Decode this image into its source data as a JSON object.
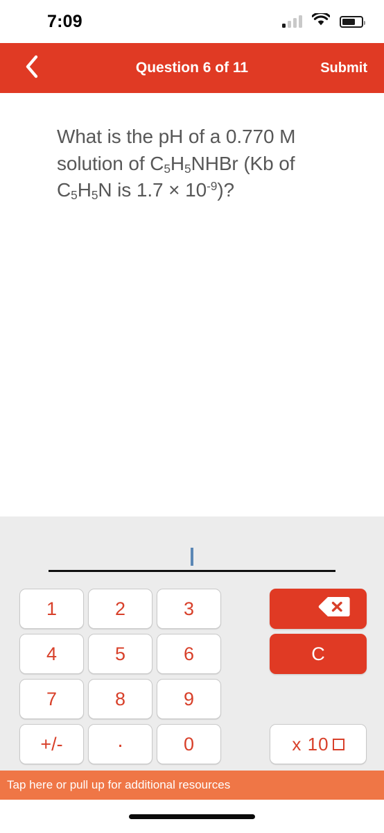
{
  "status_bar": {
    "time": "7:09",
    "signal_icon": "cellular-signal-icon",
    "wifi_icon": "wifi-icon",
    "battery_icon": "battery-icon",
    "battery_level": 70,
    "signal_bars_active": 1
  },
  "header": {
    "back_icon": "chevron-left-icon",
    "title": "Question 6 of 11",
    "submit_label": "Submit",
    "background_color": "#E03A24"
  },
  "question": {
    "line1_pre": "What is the pH of a 0.770 M",
    "full_text": "What is the pH of a 0.770 M solution of C5H5NHBr (Kb of C5H5N is 1.7 × 10⁻⁹)?",
    "segments": {
      "p1": "What is the pH of a 0.770 M solution of C",
      "sub1": "5",
      "p2": "H",
      "sub2": "5",
      "p3": "NHBr (Kb of C",
      "sub3": "5",
      "p4": "H",
      "sub4": "5",
      "p5": "N is 1.7 × 10",
      "sup1": "-9",
      "p6": ")?"
    },
    "text_color": "#575757"
  },
  "answer_input": {
    "value": "",
    "caret_visible": true,
    "caret_color": "#5b87b5",
    "underline_color": "#101010"
  },
  "keypad": {
    "background_color": "#ECECEC",
    "number_keys": [
      "1",
      "2",
      "3",
      "4",
      "5",
      "6",
      "7",
      "8",
      "9",
      "+/-",
      ".",
      "0"
    ],
    "key_text_color": "#D8402A",
    "side_keys": [
      {
        "name": "backspace",
        "label": "",
        "icon": "backspace-icon",
        "style": "red"
      },
      {
        "name": "clear",
        "label": "C",
        "icon": "",
        "style": "red"
      },
      {
        "name": "scientific-notation",
        "label": "x 10",
        "icon": "exponent-box",
        "style": "light"
      }
    ]
  },
  "footer": {
    "resources_label": "Tap here or pull up for additional resources",
    "background_color": "#EF7646",
    "home_indicator": "home-indicator"
  }
}
